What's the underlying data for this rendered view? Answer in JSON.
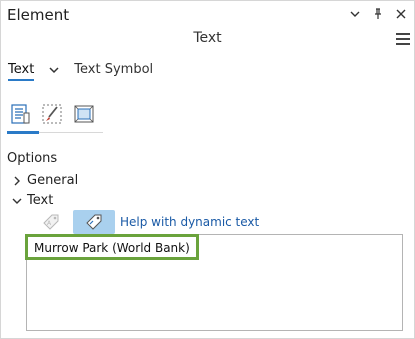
{
  "panel": {
    "title": "Element",
    "subtitle": "Text"
  },
  "titlebar_icons": [
    "chevron-down-icon",
    "pin-icon",
    "close-icon"
  ],
  "menu_icon": "hamburger-menu-icon",
  "tabs": [
    {
      "label": "Text",
      "active": true
    },
    {
      "label": "Text Symbol",
      "active": false
    }
  ],
  "views": [
    {
      "icon": "text-properties-icon",
      "active": true
    },
    {
      "icon": "brush-icon",
      "active": false
    },
    {
      "icon": "display-frame-icon",
      "active": false
    }
  ],
  "options": {
    "heading": "Options",
    "general_label": "General",
    "text_label": "Text"
  },
  "dynamic_text": {
    "link_label": "Help with dynamic text"
  },
  "text_value": "Murrow Park (World Bank)",
  "colors": {
    "accent": "#2a7ac7",
    "highlight_border": "#6aa33c",
    "active_button": "#a9d0ee",
    "link": "#1a5aa6"
  }
}
